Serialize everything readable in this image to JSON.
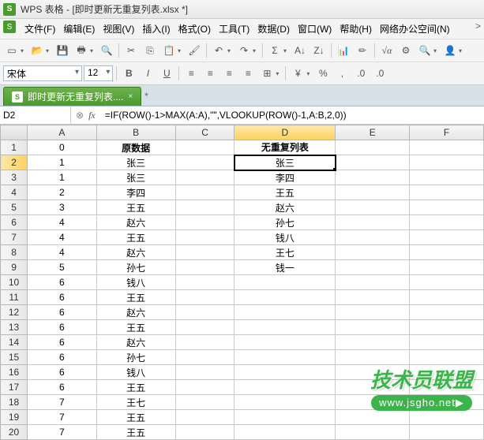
{
  "title": {
    "app": "WPS 表格",
    "doc": "[即时更新无重复列表.xlsx *]"
  },
  "menus": [
    "文件(F)",
    "编辑(E)",
    "视图(V)",
    "插入(I)",
    "格式(O)",
    "工具(T)",
    "数据(D)",
    "窗口(W)",
    "帮助(H)",
    "网络办公空间(N)"
  ],
  "font": {
    "name": "宋体",
    "size": "12"
  },
  "tab": {
    "label": "即时更新无重复列表...."
  },
  "formula": {
    "ref": "D2",
    "value": "=IF(ROW()-1>MAX(A:A),\"\",VLOOKUP(ROW()-1,A:B,2,0))"
  },
  "columns": [
    "A",
    "B",
    "C",
    "D",
    "E",
    "F"
  ],
  "headerRow": {
    "A": "0",
    "B": "原数据",
    "D": "无重复列表"
  },
  "rows": [
    {
      "n": 1,
      "A": "0",
      "B": "原数据",
      "D": "无重复列表"
    },
    {
      "n": 2,
      "A": "1",
      "B": "张三",
      "D": "张三"
    },
    {
      "n": 3,
      "A": "1",
      "B": "张三",
      "D": "李四"
    },
    {
      "n": 4,
      "A": "2",
      "B": "李四",
      "D": "王五"
    },
    {
      "n": 5,
      "A": "3",
      "B": "王五",
      "D": "赵六"
    },
    {
      "n": 6,
      "A": "4",
      "B": "赵六",
      "D": "孙七"
    },
    {
      "n": 7,
      "A": "4",
      "B": "王五",
      "D": "钱八"
    },
    {
      "n": 8,
      "A": "4",
      "B": "赵六",
      "D": "王七"
    },
    {
      "n": 9,
      "A": "5",
      "B": "孙七",
      "D": "钱一"
    },
    {
      "n": 10,
      "A": "6",
      "B": "钱八",
      "D": ""
    },
    {
      "n": 11,
      "A": "6",
      "B": "王五",
      "D": ""
    },
    {
      "n": 12,
      "A": "6",
      "B": "赵六",
      "D": ""
    },
    {
      "n": 13,
      "A": "6",
      "B": "王五",
      "D": ""
    },
    {
      "n": 14,
      "A": "6",
      "B": "赵六",
      "D": ""
    },
    {
      "n": 15,
      "A": "6",
      "B": "孙七",
      "D": ""
    },
    {
      "n": 16,
      "A": "6",
      "B": "钱八",
      "D": ""
    },
    {
      "n": 17,
      "A": "6",
      "B": "王五",
      "D": ""
    },
    {
      "n": 18,
      "A": "7",
      "B": "王七",
      "D": ""
    },
    {
      "n": 19,
      "A": "7",
      "B": "王五",
      "D": ""
    },
    {
      "n": 20,
      "A": "7",
      "B": "王五",
      "D": ""
    }
  ],
  "selected": {
    "row": 2,
    "col": "D"
  },
  "watermark": {
    "top": "技术员联盟",
    "bottom": "www.jsgho.net▶"
  }
}
